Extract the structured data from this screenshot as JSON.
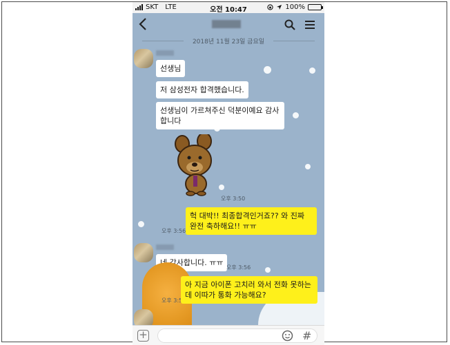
{
  "status": {
    "carrier": "SKT",
    "network": "LTE",
    "time": "오전 10:47",
    "battery": "100%",
    "battery_level": 1.0
  },
  "header": {
    "back_icon": "chevron-left-icon",
    "search_icon": "search-icon",
    "menu_icon": "hamburger-menu-icon"
  },
  "date_divider": "2018년 11월 23일 금요일",
  "messages": [
    {
      "side": "in",
      "text": "선생님"
    },
    {
      "side": "in",
      "text": "저 삼성전자 합격했습니다."
    },
    {
      "side": "in",
      "text": "선생님이 가르쳐주신 덕분이예요 감사합니다"
    },
    {
      "side": "in",
      "type": "sticker",
      "sticker": "bear-emoticon",
      "time": "오후 3:50"
    },
    {
      "side": "out",
      "text": "헉 대박!! 최종합격인거죠?? 와 진짜 완전 축하해요!! ㅠㅠ",
      "time": "오후 3:56"
    },
    {
      "side": "in",
      "text": "네 감사합니다. ㅠㅠ",
      "time": "오후 3:56"
    },
    {
      "side": "out",
      "text": "아 지금 아이폰 고치러 와서 전화 못하는데 이따가 통화 가능해요?",
      "time": "오후 3:56"
    }
  ],
  "input": {
    "plus_label": "+",
    "emoji_icon": "emoji-icon",
    "hash_label": "#"
  },
  "colors": {
    "chat_bg": "#9bb3cb",
    "bubble_in": "#ffffff",
    "bubble_out": "#fef01b"
  }
}
